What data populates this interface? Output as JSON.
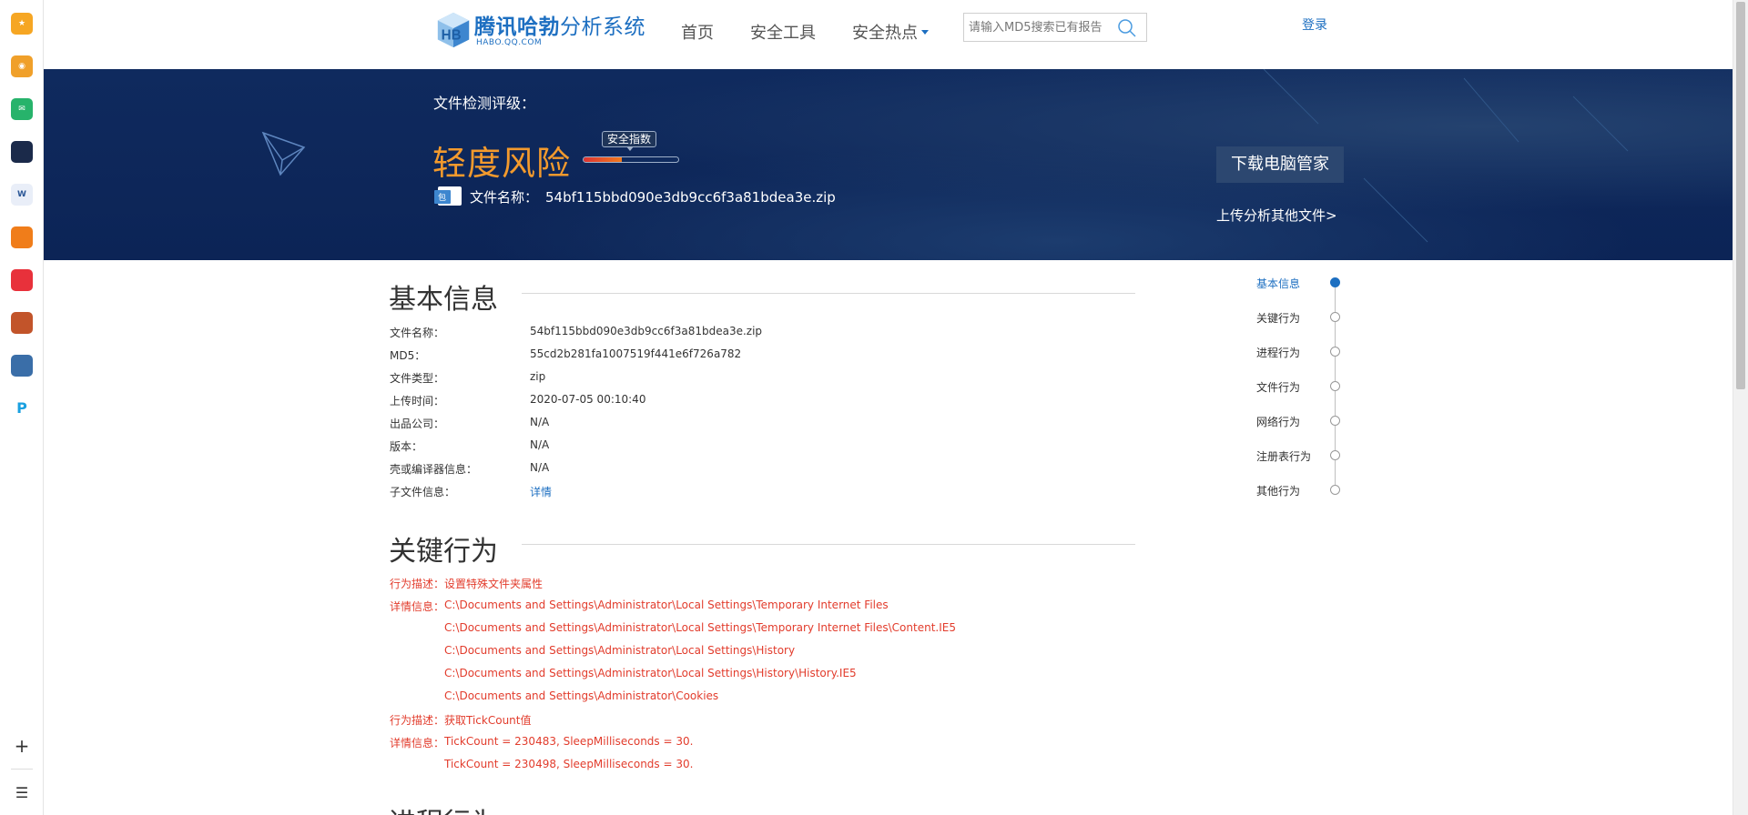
{
  "dock": {
    "items": [
      {
        "name": "favorites-app-icon",
        "color": "#f6a623",
        "glyph": "★"
      },
      {
        "name": "weibo-app-icon",
        "color": "#f0a02a",
        "glyph": "◉"
      },
      {
        "name": "mail-app-icon",
        "color": "#27b36b",
        "glyph": "✉"
      },
      {
        "name": "news-app-icon",
        "color": "#1b2a4a",
        "glyph": ""
      },
      {
        "name": "document-app-icon",
        "color": "#e9eef8",
        "glyph": "W"
      },
      {
        "name": "novel-app-icon",
        "color": "#f07d1a",
        "glyph": ""
      },
      {
        "name": "red-app-icon",
        "color": "#e8313b",
        "glyph": ""
      },
      {
        "name": "game-app-icon",
        "color": "#c2542a",
        "glyph": ""
      },
      {
        "name": "game2-app-icon",
        "color": "#3a6ea8",
        "glyph": ""
      },
      {
        "name": "ip-app-icon",
        "color": "#ffffff",
        "glyph": "P"
      }
    ]
  },
  "header": {
    "logo_cn_bold": "腾讯哈勃",
    "logo_cn_light": "分析系统",
    "logo_en": "HABO.QQ.COM",
    "nav": [
      "首页",
      "安全工具",
      "安全热点"
    ],
    "search_placeholder": "请输入MD5搜索已有报告",
    "login": "登录"
  },
  "banner": {
    "rating_label": "文件检测评级：",
    "risk_level": "轻度风险",
    "score_badge": "安全指数",
    "score_fraction": 0.4,
    "file_label": "文件名称：",
    "file_name": "54bf115bbd090e3db9cc6f3a81bdea3e.zip",
    "download_button": "下载电脑管家",
    "upload_link": "上传分析其他文件>"
  },
  "basic_info": {
    "title": "基本信息",
    "rows": [
      {
        "label": "文件名称：",
        "value": "54bf115bbd090e3db9cc6f3a81bdea3e.zip"
      },
      {
        "label": "MD5：",
        "value": "55cd2b281fa1007519f441e6f726a782"
      },
      {
        "label": "文件类型：",
        "value": "zip"
      },
      {
        "label": "上传时间：",
        "value": "2020-07-05 00:10:40"
      },
      {
        "label": "出品公司：",
        "value": "N/A"
      },
      {
        "label": "版本：",
        "value": "N/A"
      },
      {
        "label": "壳或编译器信息：",
        "value": "N/A"
      },
      {
        "label": "子文件信息：",
        "value": "详情"
      }
    ]
  },
  "key_behavior": {
    "title": "关键行为",
    "lines": [
      {
        "prefix": "行为描述：",
        "text": "设置特殊文件夹属性"
      },
      {
        "prefix": "详情信息：",
        "text": "C:\\Documents and Settings\\Administrator\\Local Settings\\Temporary Internet Files"
      },
      {
        "prefix": "",
        "text": "C:\\Documents and Settings\\Administrator\\Local Settings\\Temporary Internet Files\\Content.IE5"
      },
      {
        "prefix": "",
        "text": "C:\\Documents and Settings\\Administrator\\Local Settings\\History"
      },
      {
        "prefix": "",
        "text": "C:\\Documents and Settings\\Administrator\\Local Settings\\History\\History.IE5"
      },
      {
        "prefix": "",
        "text": "C:\\Documents and Settings\\Administrator\\Cookies"
      },
      {
        "prefix": "行为描述：",
        "text": "获取TickCount值"
      },
      {
        "prefix": "详情信息：",
        "text": "TickCount = 230483, SleepMilliseconds = 30."
      },
      {
        "prefix": "",
        "text": "TickCount = 230498, SleepMilliseconds = 30."
      }
    ]
  },
  "next_section_title": "进程行为",
  "side_nav": {
    "items": [
      "基本信息",
      "关键行为",
      "进程行为",
      "文件行为",
      "网络行为",
      "注册表行为",
      "其他行为"
    ],
    "active_index": 0
  }
}
